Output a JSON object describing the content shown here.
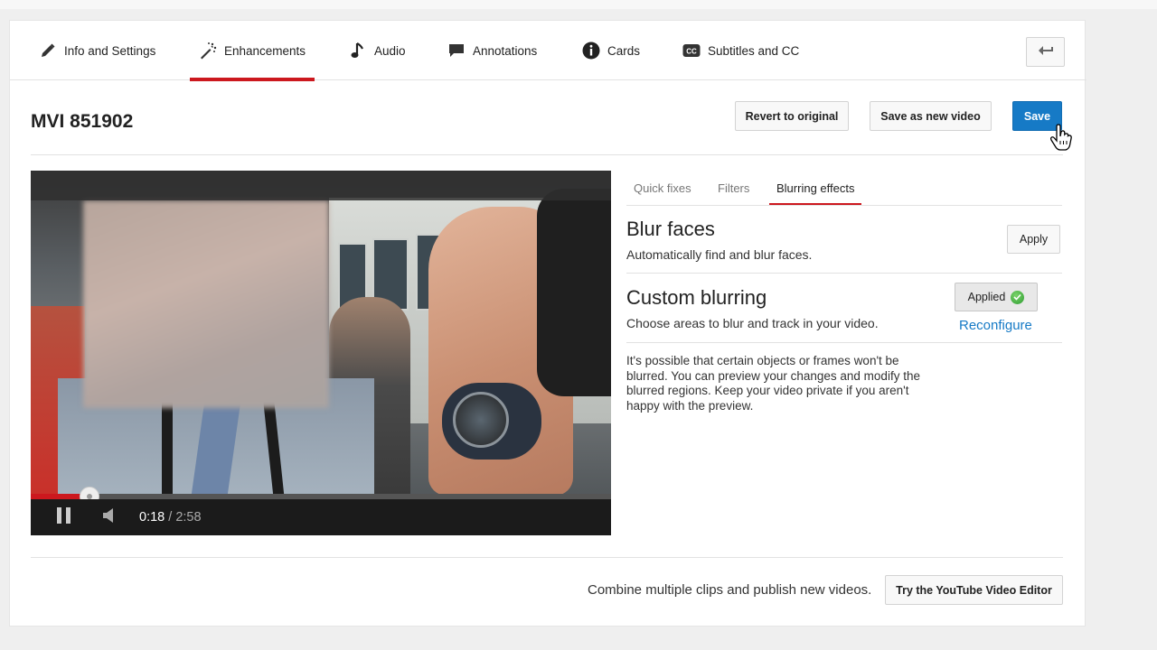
{
  "nav": {
    "tabs": [
      {
        "label": "Info and Settings",
        "icon": "pencil-icon"
      },
      {
        "label": "Enhancements",
        "icon": "magic-wand-icon",
        "active": true
      },
      {
        "label": "Audio",
        "icon": "music-note-icon"
      },
      {
        "label": "Annotations",
        "icon": "speech-bubble-icon"
      },
      {
        "label": "Cards",
        "icon": "info-circle-icon"
      },
      {
        "label": "Subtitles and CC",
        "icon": "cc-icon"
      }
    ],
    "back_icon": "back-arrow-icon"
  },
  "header": {
    "title": "MVI 851902",
    "revert_label": "Revert to original",
    "save_new_label": "Save as new video",
    "save_label": "Save"
  },
  "player": {
    "current_time": "0:18",
    "separator": "/",
    "duration": "2:58",
    "played_fraction": 0.101,
    "pause_icon": "pause-icon",
    "volume_icon": "speaker-icon"
  },
  "panel": {
    "tabs": [
      {
        "label": "Quick fixes"
      },
      {
        "label": "Filters"
      },
      {
        "label": "Blurring effects",
        "active": true
      }
    ],
    "blur_faces": {
      "title": "Blur faces",
      "desc": "Automatically find and blur faces.",
      "button": "Apply"
    },
    "custom_blurring": {
      "title": "Custom blurring",
      "desc": "Choose areas to blur and track in your video.",
      "status": "Applied",
      "link": "Reconfigure"
    },
    "note": "It's possible that certain objects or frames won't be blurred. You can preview your changes and modify the blurred regions. Keep your video private if you aren't happy with the preview."
  },
  "footer": {
    "text": "Combine multiple clips and publish new videos.",
    "button": "Try the YouTube Video Editor"
  },
  "colors": {
    "accent_red": "#cc181e",
    "primary_blue": "#167ac6"
  }
}
